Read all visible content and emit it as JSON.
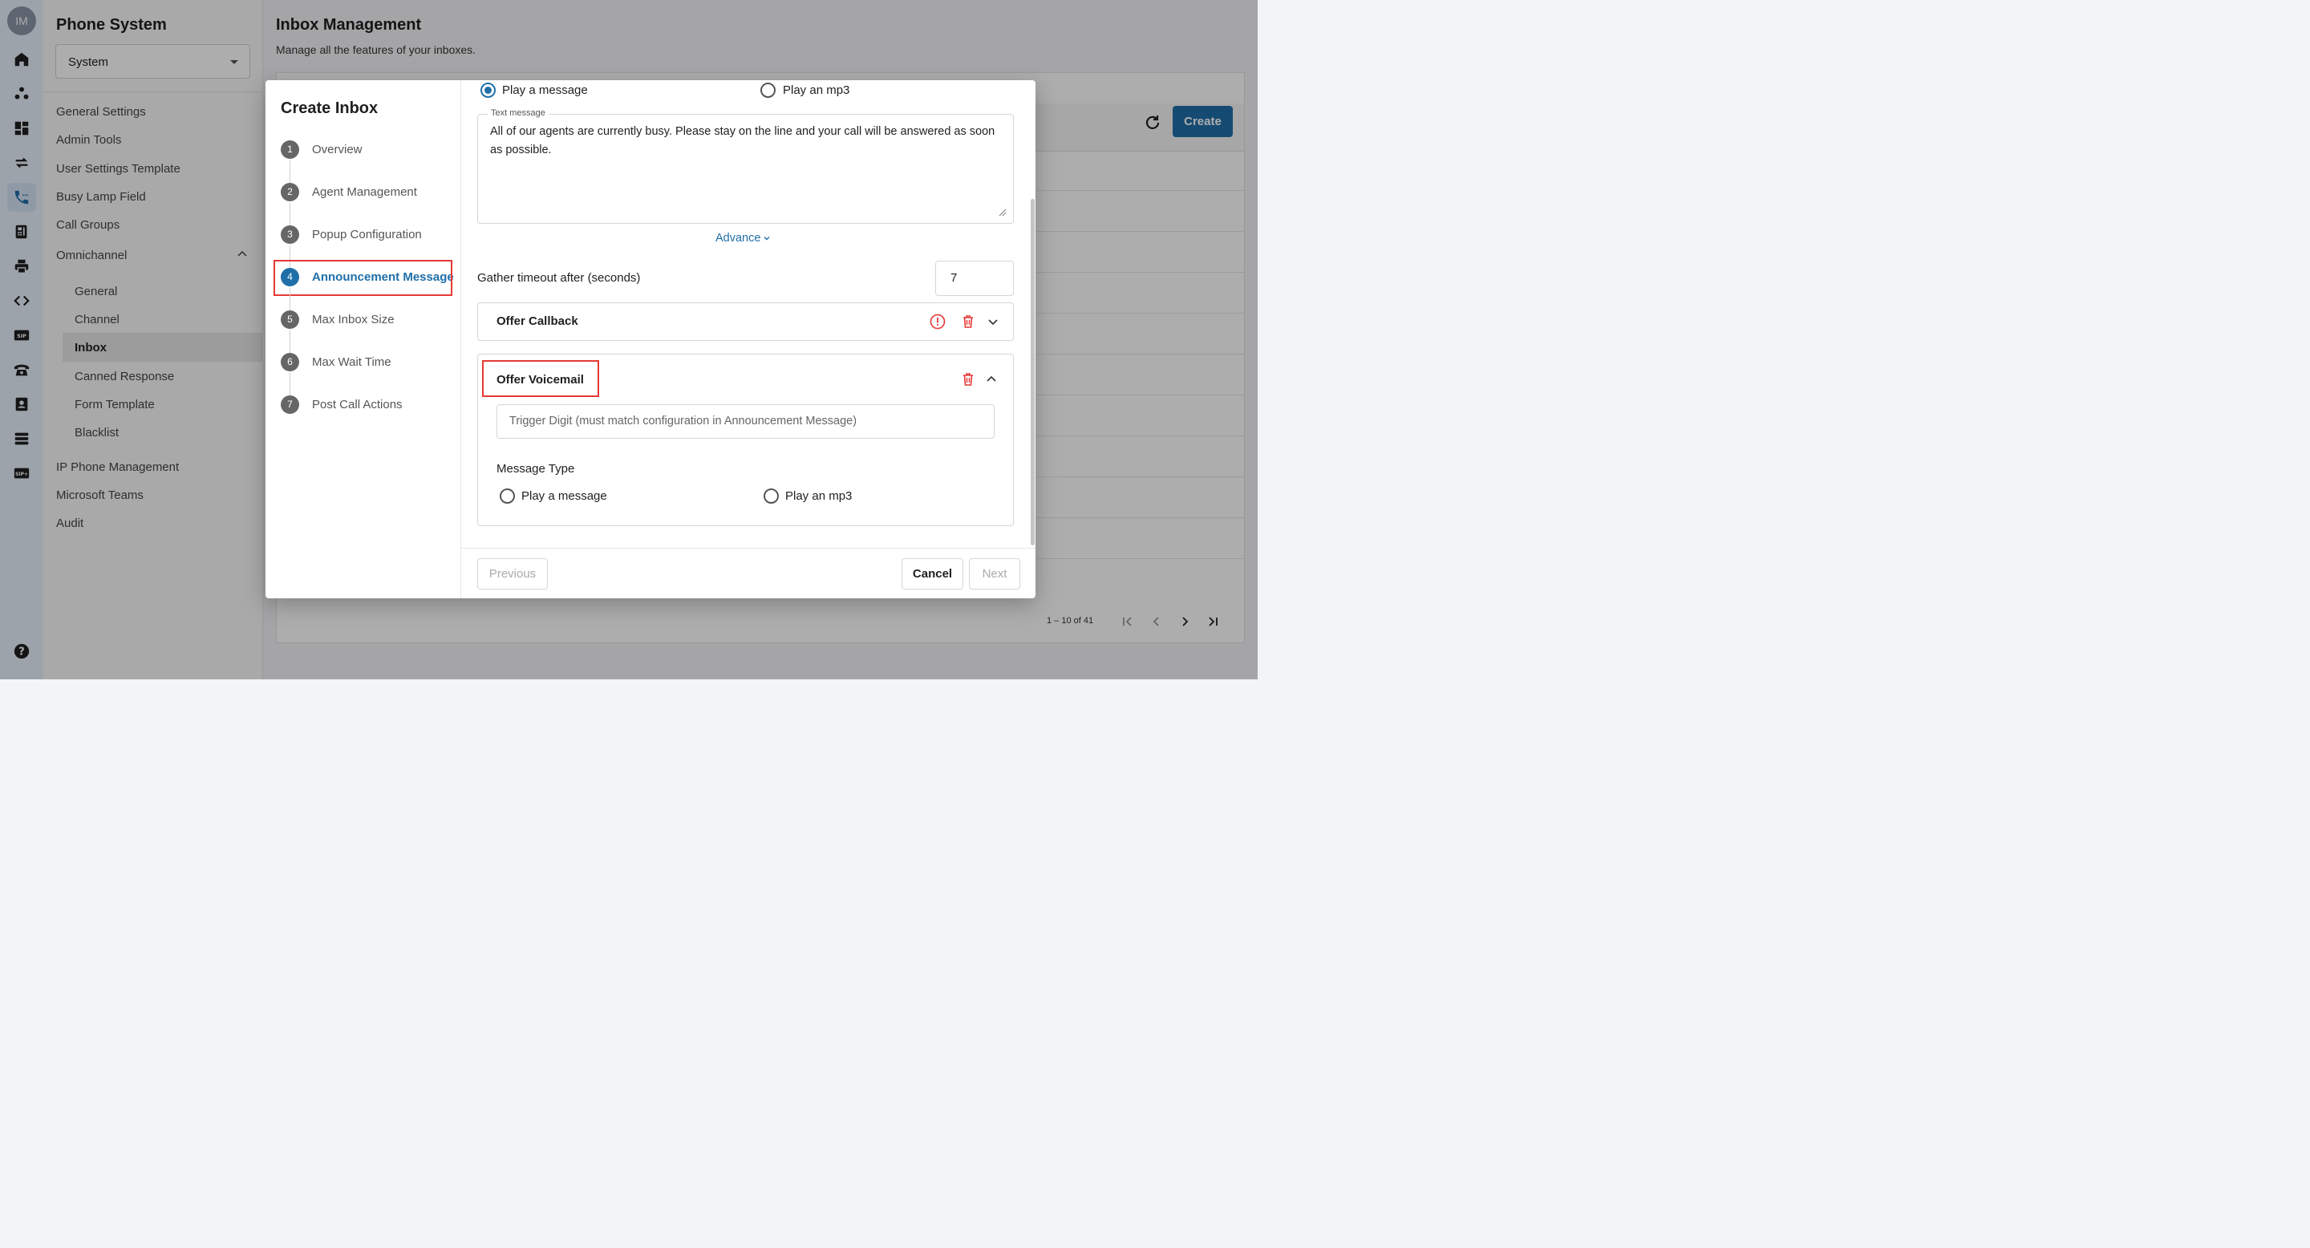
{
  "user": {
    "initials": "IM"
  },
  "sidebar": {
    "title": "Phone System",
    "selector_value": "System",
    "items": [
      {
        "label": "General Settings"
      },
      {
        "label": "Admin Tools"
      },
      {
        "label": "User Settings Template"
      },
      {
        "label": "Busy Lamp Field"
      },
      {
        "label": "Call Groups"
      },
      {
        "label": "Omnichannel"
      }
    ],
    "omnichannel_items": [
      {
        "label": "General"
      },
      {
        "label": "Channel"
      },
      {
        "label": "Inbox"
      },
      {
        "label": "Canned Response"
      },
      {
        "label": "Form Template"
      },
      {
        "label": "Blacklist"
      }
    ],
    "bottom_items": [
      {
        "label": "IP Phone Management"
      },
      {
        "label": "Microsoft Teams"
      },
      {
        "label": "Audit"
      }
    ]
  },
  "page": {
    "title": "Inbox Management",
    "subtitle": "Manage all the features of your inboxes.",
    "create_label": "Create",
    "pagination": "1 – 10 of 41"
  },
  "dialog": {
    "title": "Create Inbox",
    "steps": [
      {
        "num": "1",
        "label": "Overview"
      },
      {
        "num": "2",
        "label": "Agent Management"
      },
      {
        "num": "3",
        "label": "Popup Configuration"
      },
      {
        "num": "4",
        "label": "Announcement Message"
      },
      {
        "num": "5",
        "label": "Max Inbox Size"
      },
      {
        "num": "6",
        "label": "Max Wait Time"
      },
      {
        "num": "7",
        "label": "Post Call Actions"
      }
    ],
    "message_type": {
      "option_message": "Play a message",
      "option_mp3": "Play an mp3"
    },
    "text_message": {
      "label": "Text message",
      "value": "All of our agents are currently busy. Please stay on the line and your call will be answered as soon as possible."
    },
    "advance_label": "Advance",
    "gather": {
      "label": "Gather timeout after (seconds)",
      "value": "7"
    },
    "offer_callback": {
      "title": "Offer Callback"
    },
    "offer_voicemail": {
      "title": "Offer Voicemail",
      "trigger_placeholder": "Trigger Digit (must match configuration in Announcement Message)",
      "message_type_label": "Message Type",
      "option_message": "Play a message",
      "option_mp3": "Play an mp3"
    },
    "buttons": {
      "previous": "Previous",
      "cancel": "Cancel",
      "next": "Next"
    }
  }
}
